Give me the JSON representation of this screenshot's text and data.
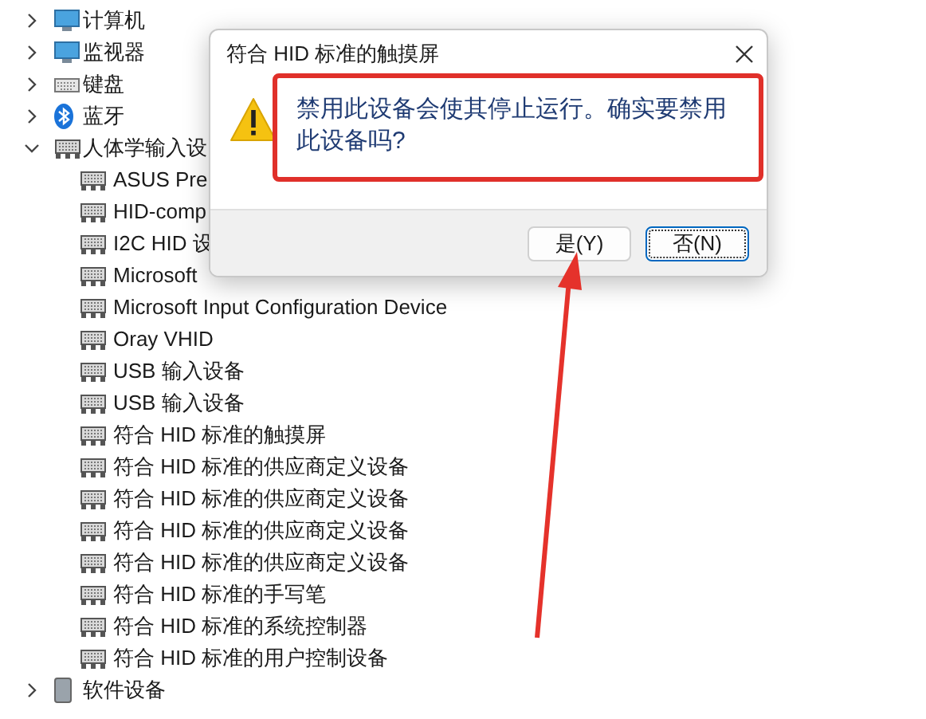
{
  "tree": [
    {
      "label": "计算机",
      "kind": "computer",
      "expanded": false
    },
    {
      "label": "监视器",
      "kind": "monitor",
      "expanded": false
    },
    {
      "label": "键盘",
      "kind": "keyboard",
      "expanded": false
    },
    {
      "label": "蓝牙",
      "kind": "bluetooth",
      "expanded": false
    },
    {
      "label": "人体学输入设",
      "kind": "hid",
      "expanded": true,
      "children": [
        {
          "label": "ASUS Pre",
          "kind": "hid"
        },
        {
          "label": "HID-comp",
          "kind": "hid"
        },
        {
          "label": "I2C HID 设",
          "kind": "hid"
        },
        {
          "label": "Microsoft",
          "kind": "hid"
        },
        {
          "label": "Microsoft Input Configuration Device",
          "kind": "hid"
        },
        {
          "label": "Oray VHID",
          "kind": "hid"
        },
        {
          "label": "USB 输入设备",
          "kind": "hid"
        },
        {
          "label": "USB 输入设备",
          "kind": "hid"
        },
        {
          "label": "符合 HID 标准的触摸屏",
          "kind": "hid"
        },
        {
          "label": "符合 HID 标准的供应商定义设备",
          "kind": "hid"
        },
        {
          "label": "符合 HID 标准的供应商定义设备",
          "kind": "hid"
        },
        {
          "label": "符合 HID 标准的供应商定义设备",
          "kind": "hid"
        },
        {
          "label": "符合 HID 标准的供应商定义设备",
          "kind": "hid"
        },
        {
          "label": "符合 HID 标准的手写笔",
          "kind": "hid"
        },
        {
          "label": "符合 HID 标准的系统控制器",
          "kind": "hid"
        },
        {
          "label": "符合 HID 标准的用户控制设备",
          "kind": "hid"
        }
      ]
    },
    {
      "label": "软件设备",
      "kind": "software",
      "expanded": false
    }
  ],
  "dialog": {
    "title": "符合 HID 标准的触摸屏",
    "message": "禁用此设备会使其停止运行。确实要禁用此设备吗?",
    "buttons": [
      {
        "label": "是(Y)",
        "focused": false
      },
      {
        "label": "否(N)",
        "focused": true
      }
    ]
  }
}
